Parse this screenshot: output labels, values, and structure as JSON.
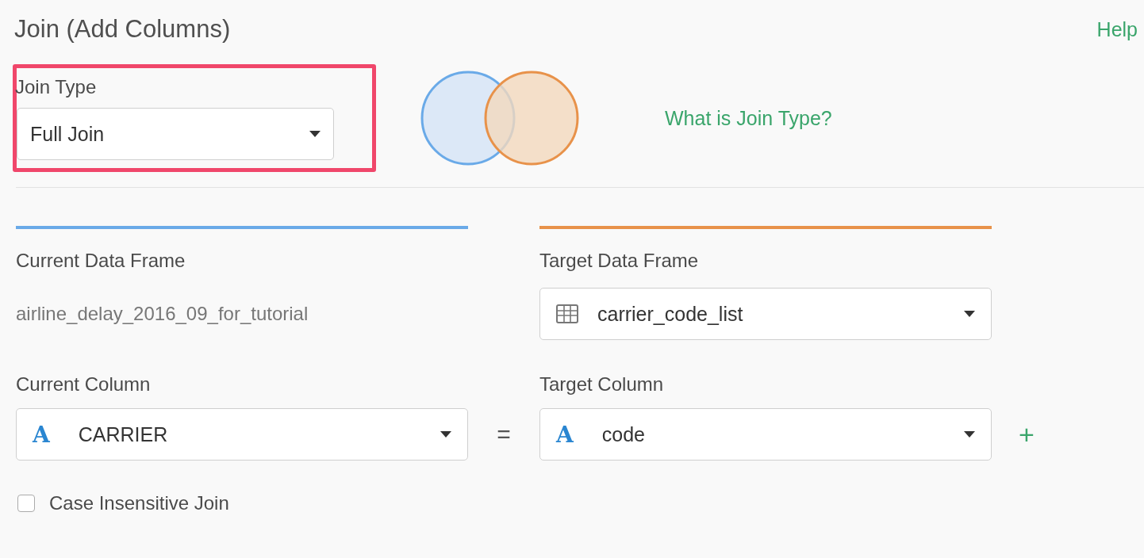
{
  "title": "Join (Add Columns)",
  "help_link": "Help",
  "join_type": {
    "label": "Join Type",
    "value": "Full Join",
    "highlighted": true
  },
  "join_type_link": "What is Join Type?",
  "current": {
    "label": "Current Data Frame",
    "value": "airline_delay_2016_09_for_tutorial"
  },
  "target": {
    "label": "Target Data Frame",
    "value": "carrier_code_list"
  },
  "current_column": {
    "label": "Current Column",
    "type_glyph": "A",
    "value": "CARRIER"
  },
  "equals": "=",
  "target_column": {
    "label": "Target Column",
    "type_glyph": "A",
    "value": "code"
  },
  "add_button": "+",
  "case_insensitive": {
    "label": "Case Insensitive Join",
    "checked": false
  }
}
